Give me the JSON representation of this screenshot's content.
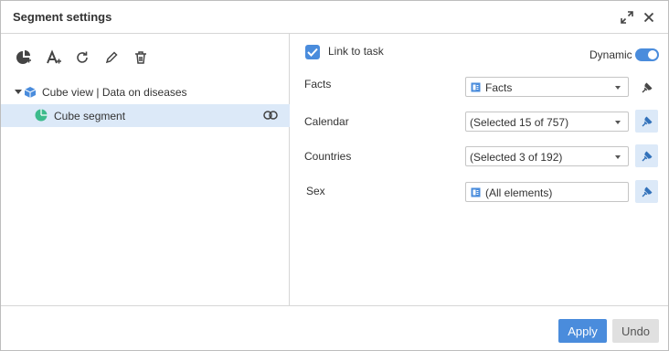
{
  "window": {
    "title": "Segment settings",
    "maximize_icon": "expand-arrows-icon",
    "close_icon": "close-icon"
  },
  "toolbar": {
    "icons": [
      "add-segment-icon",
      "add-text-icon",
      "refresh-icon",
      "edit-icon",
      "delete-icon"
    ]
  },
  "tree": {
    "root_label": "Cube view | Data on diseases",
    "child_label": "Cube segment"
  },
  "settings": {
    "link_label": "Link to task",
    "link_checked": true,
    "dynamic_label": "Dynamic",
    "dynamic_on": true,
    "rows": [
      {
        "label": "Facts",
        "value": "Facts",
        "has_icon": true,
        "dropdown": true,
        "pin_active": false
      },
      {
        "label": "Calendar",
        "value": "(Selected 15 of 757)",
        "has_icon": false,
        "dropdown": true,
        "pin_active": true
      },
      {
        "label": "Countries",
        "value": "(Selected 3 of 192)",
        "has_icon": false,
        "dropdown": true,
        "pin_active": true
      },
      {
        "label": "Sex",
        "value": "(All elements)",
        "has_icon": true,
        "dropdown": false,
        "pin_active": true
      }
    ]
  },
  "footer": {
    "apply_label": "Apply",
    "undo_label": "Undo"
  },
  "colors": {
    "accent": "#4a8cdc",
    "selection": "#dce9f8",
    "segment_green": "#3dbb8c"
  }
}
